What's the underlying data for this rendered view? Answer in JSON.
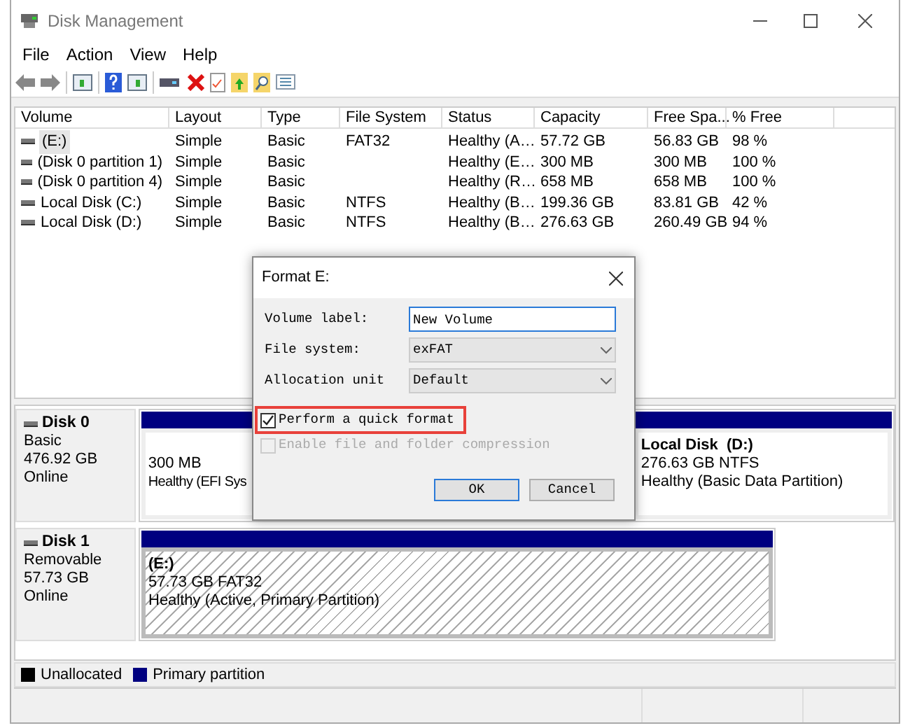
{
  "window": {
    "title": "Disk Management"
  },
  "menu": [
    "File",
    "Action",
    "View",
    "Help"
  ],
  "volumes": {
    "columns": [
      "Volume",
      "Layout",
      "Type",
      "File System",
      "Status",
      "Capacity",
      "Free Spa...",
      "% Free"
    ],
    "rows": [
      {
        "selected": true,
        "cells": [
          "(E:)",
          "Simple",
          "Basic",
          "FAT32",
          "Healthy (A…",
          "57.72 GB",
          "56.83 GB",
          "98 %"
        ]
      },
      {
        "selected": false,
        "cells": [
          "(Disk 0 partition 1)",
          "Simple",
          "Basic",
          "",
          "Healthy (E…",
          "300 MB",
          "300 MB",
          "100 %"
        ]
      },
      {
        "selected": false,
        "cells": [
          "(Disk 0 partition 4)",
          "Simple",
          "Basic",
          "",
          "Healthy (R…",
          "658 MB",
          "658 MB",
          "100 %"
        ]
      },
      {
        "selected": false,
        "cells": [
          "Local Disk (C:)",
          "Simple",
          "Basic",
          "NTFS",
          "Healthy (B…",
          "199.36 GB",
          "83.81 GB",
          "42 %"
        ]
      },
      {
        "selected": false,
        "cells": [
          "Local Disk (D:)",
          "Simple",
          "Basic",
          "NTFS",
          "Healthy (B…",
          "276.63 GB",
          "260.49 GB",
          "94 %"
        ]
      }
    ]
  },
  "disks": [
    {
      "name": "Disk 0",
      "type": "Basic",
      "size": "476.92 GB",
      "status": "Online",
      "partitions": [
        {
          "selected": false,
          "size": "300 MB",
          "health": "Healthy (EFI Sys"
        },
        {
          "selected": false,
          "label": "Local Disk  (D:)",
          "size": "276.63 GB NTFS",
          "health": "Healthy (Basic Data Partition)"
        }
      ]
    },
    {
      "name": "Disk 1",
      "type": "Removable",
      "size": "57.73 GB",
      "status": "Online",
      "partitions": [
        {
          "selected": true,
          "label": "(E:)",
          "size": "57.73 GB FAT32",
          "health": "Healthy (Active, Primary Partition)"
        }
      ]
    }
  ],
  "legend": [
    {
      "label": "Unallocated",
      "color": "#000000"
    },
    {
      "label": "Primary partition",
      "color": "#000080"
    }
  ],
  "dialog": {
    "title": "Format E:",
    "fields": [
      {
        "kind": "text",
        "label": "Volume label:",
        "value": "New Volume"
      },
      {
        "kind": "select",
        "label": "File system:",
        "value": "exFAT"
      },
      {
        "kind": "select",
        "label": "Allocation unit",
        "value": "Default"
      }
    ],
    "options": [
      {
        "label": "Perform a quick format",
        "checked": true,
        "disabled": false,
        "highlighted": true
      },
      {
        "label": "Enable file and folder compression",
        "checked": false,
        "disabled": true,
        "highlighted": false
      }
    ],
    "buttons": [
      {
        "label": "OK",
        "default": true
      },
      {
        "label": "Cancel",
        "default": false
      }
    ]
  }
}
